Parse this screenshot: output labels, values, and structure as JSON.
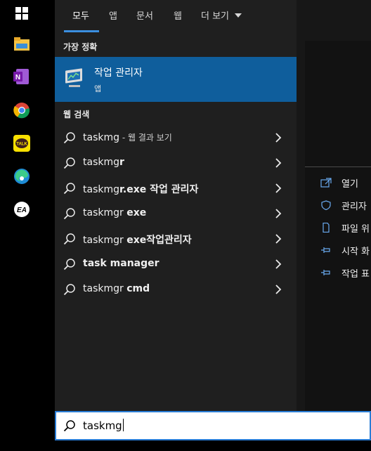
{
  "tabs": [
    {
      "label": "모두"
    },
    {
      "label": "앱"
    },
    {
      "label": "문서"
    },
    {
      "label": "웹"
    },
    {
      "label": "더 보기"
    }
  ],
  "sections": {
    "best_match": "가장 정확",
    "web_search": "웹 검색"
  },
  "best_match": {
    "title": "작업 관리자",
    "subtitle": "앱",
    "icon": "task-manager-icon"
  },
  "web_results": [
    {
      "pre": "taskmg",
      "bold": "",
      "post": "",
      "muted": " - 웹 결과 보기"
    },
    {
      "pre": "taskmg",
      "bold": "r",
      "post": "",
      "muted": ""
    },
    {
      "pre": "taskmg",
      "bold": "r.exe 작업 관리자",
      "post": "",
      "muted": ""
    },
    {
      "pre": "taskmgr ",
      "bold": "exe",
      "post": "",
      "muted": ""
    },
    {
      "pre": "taskmgr ",
      "bold": "exe작업관리자",
      "post": "",
      "muted": ""
    },
    {
      "pre": "",
      "bold": "task manager",
      "post": "",
      "muted": ""
    },
    {
      "pre": "taskmgr ",
      "bold": "cmd",
      "post": "",
      "muted": ""
    }
  ],
  "actions": [
    {
      "label": "열기",
      "icon": "open-icon"
    },
    {
      "label": "관리자",
      "icon": "shield-icon"
    },
    {
      "label": "파일 위",
      "icon": "file-location-icon"
    },
    {
      "label": "시작 화",
      "icon": "pin-icon"
    },
    {
      "label": "작업 표",
      "icon": "pin-icon"
    }
  ],
  "search": {
    "value": "taskmg"
  },
  "taskbar_icons": [
    "windows-icon",
    "file-explorer-icon",
    "onenote-icon",
    "chrome-icon",
    "kakaotalk-icon",
    "edge-icon",
    "ea-icon"
  ],
  "colors": {
    "accent": "#0f5e9c",
    "tab_underline": "#3b8fe0",
    "search_border": "#2a7dd6"
  }
}
